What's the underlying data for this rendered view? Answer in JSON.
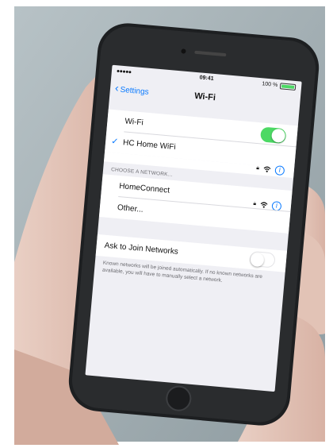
{
  "status_bar": {
    "carrier": "●●●●● ",
    "time": "09:41",
    "battery": "100 %"
  },
  "nav": {
    "back_label": "Settings",
    "title": "Wi-Fi"
  },
  "wifi_toggle": {
    "label": "Wi-Fi",
    "on": true
  },
  "connected": {
    "network": "HC Home WiFi",
    "secured": true
  },
  "choose_header": "CHOOSE A NETWORK...",
  "networks": [
    {
      "name": "HomeConnect",
      "secured": true
    },
    {
      "name": "Other..."
    }
  ],
  "ask_to_join": {
    "label": "Ask to Join Networks",
    "on": false,
    "footer": "Known networks will be joined automatically. If no known networks are available, you will have to manually select a network."
  },
  "icons": [
    "back-chevron-icon",
    "wifi-icon",
    "lock-icon",
    "info-icon",
    "checkmark-icon",
    "battery-icon"
  ],
  "colors": {
    "accent": "#0a7aff",
    "toggle_on": "#4cd964",
    "background": "#efeff4"
  }
}
